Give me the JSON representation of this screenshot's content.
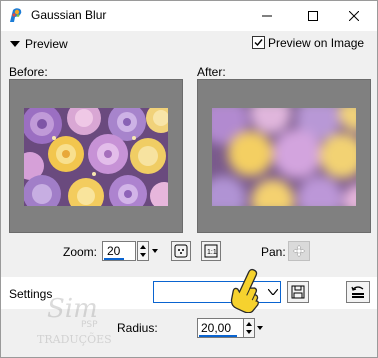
{
  "window": {
    "title": "Gaussian Blur",
    "controls": {
      "minimize": "minimize",
      "maximize": "maximize",
      "close": "close"
    }
  },
  "preview": {
    "section_label": "Preview",
    "preview_on_image_label": "Preview on Image",
    "preview_on_image_checked": true,
    "before_label": "Before:",
    "after_label": "After:",
    "zoom_label": "Zoom:",
    "zoom_value": "20",
    "pan_label": "Pan:"
  },
  "settings": {
    "label": "Settings",
    "preset_value": "",
    "radius_label": "Radius:",
    "radius_value": "20,00"
  },
  "watermark": {
    "line1": "Sim",
    "line2": "PSP",
    "line3": "TRADUÇÕES"
  },
  "colors": {
    "accent": "#0a64d0",
    "panel_bg": "#808080",
    "window_bg": "#f0f0f0"
  },
  "icons": {
    "app": "paintshop-pro-icon",
    "zoom_to_fit": "zoom-to-fit-icon",
    "actual_size": "actual-size-1-1-icon",
    "pan": "pan-move-icon",
    "save_preset": "save-disk-icon",
    "reset": "reset-to-default-icon",
    "pointer": "pointing-hand-icon"
  }
}
